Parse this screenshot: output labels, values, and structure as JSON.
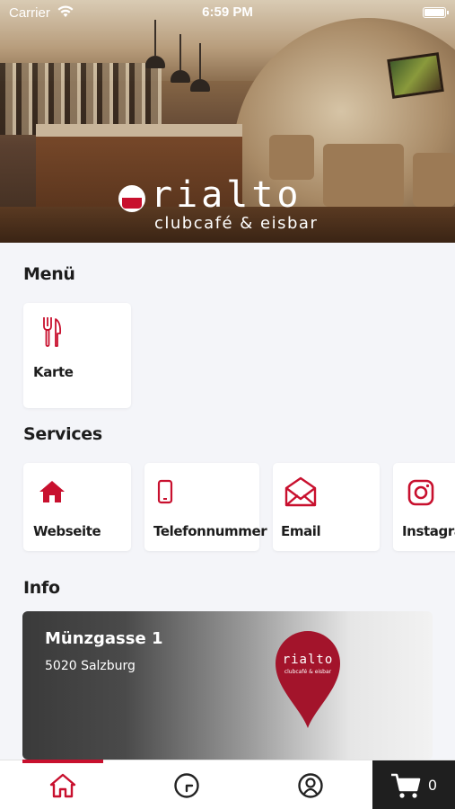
{
  "status_bar": {
    "carrier": "Carrier",
    "time": "6:59 PM"
  },
  "hero": {
    "logo_name": "rialto",
    "logo_subtitle": "clubcafé & eisbar"
  },
  "menu_section": {
    "title": "Menü",
    "items": [
      {
        "label": "Karte",
        "icon": "fork-knife-icon"
      }
    ]
  },
  "services_section": {
    "title": "Services",
    "items": [
      {
        "label": "Webseite",
        "icon": "home-icon"
      },
      {
        "label": "Telefonnummer",
        "icon": "phone-icon"
      },
      {
        "label": "Email",
        "icon": "envelope-icon"
      },
      {
        "label": "Instagram",
        "icon": "instagram-icon"
      }
    ]
  },
  "info_section": {
    "title": "Info",
    "street": "Münzgasse 1",
    "city": "5020 Salzburg",
    "pin_logo": "rialto",
    "pin_subtitle": "clubcafé & eisbar"
  },
  "tab_bar": {
    "tabs": [
      {
        "name": "home",
        "icon": "home-outline-icon",
        "active": true
      },
      {
        "name": "history",
        "icon": "clock-icon",
        "active": false
      },
      {
        "name": "account",
        "icon": "user-circle-icon",
        "active": false
      }
    ],
    "cart_count": "0"
  },
  "colors": {
    "accent": "#c8102e",
    "background": "#f4f5f9",
    "card": "#ffffff",
    "cart_bg": "#1f1f1f"
  }
}
